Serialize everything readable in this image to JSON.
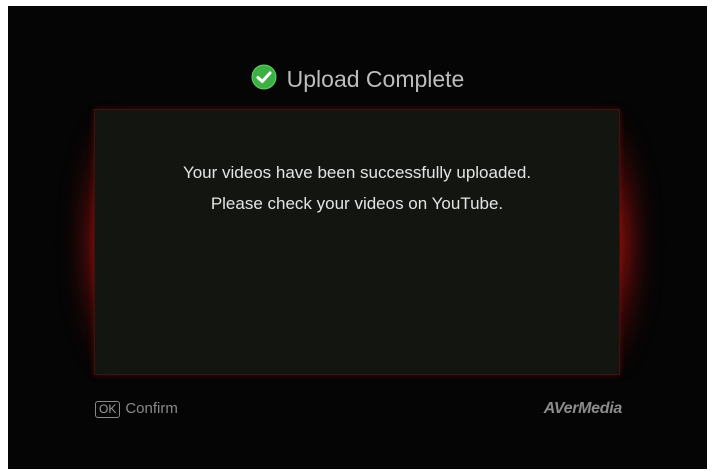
{
  "dialog": {
    "title": "Upload Complete",
    "icon": "check-circle-icon",
    "message_line1": "Your videos have been successfully uploaded.",
    "message_line2": "Please check your videos on YouTube."
  },
  "footer": {
    "ok_key": "OK",
    "confirm_label": "Confirm",
    "brand": "AVerMedia"
  },
  "colors": {
    "background": "#050505",
    "panel": "#121510",
    "accent_glow": "#e61e14",
    "check_green": "#3cb043",
    "text_primary": "#e4e4e4",
    "text_muted": "#8a8a8a"
  }
}
